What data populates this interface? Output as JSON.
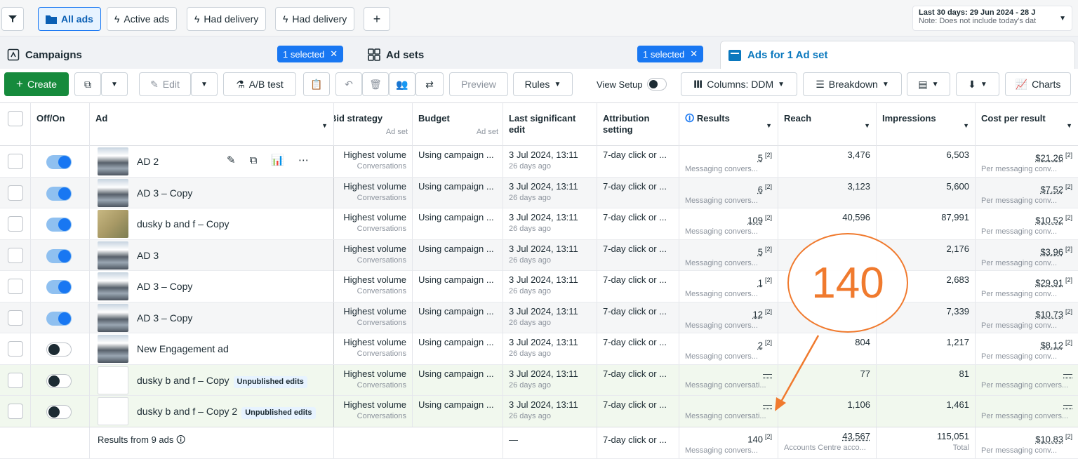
{
  "filters": {
    "all_ads": "All ads",
    "active_ads": "Active ads",
    "had_delivery_1": "Had delivery",
    "had_delivery_2": "Had delivery",
    "add": "+",
    "date_line1": "Last 30 days: 29 Jun 2024 - 28 J",
    "date_line2": "Note: Does not include today's dat"
  },
  "tabs": {
    "campaigns": "Campaigns",
    "campaigns_selected": "1 selected",
    "adsets": "Ad sets",
    "adsets_selected": "1 selected",
    "ads": "Ads for 1 Ad set"
  },
  "toolbar": {
    "create": "Create",
    "edit": "Edit",
    "ab_test": "A/B test",
    "preview": "Preview",
    "rules": "Rules",
    "view_setup": "View Setup",
    "columns": "Columns: DDM",
    "breakdown": "Breakdown",
    "charts": "Charts"
  },
  "headers": {
    "off_on": "Off/On",
    "ad": "Ad",
    "bid_strategy": "Bid strategy",
    "bid_sub": "Ad set",
    "budget": "Budget",
    "budget_sub": "Ad set",
    "last_edit": "Last significant edit",
    "attribution": "Attribution setting",
    "results": "Results",
    "reach": "Reach",
    "impressions": "Impressions",
    "cpr": "Cost per result"
  },
  "rows": [
    {
      "on": true,
      "thumb": "photo",
      "name": "AD 2",
      "badge": "",
      "bid": "Highest volume",
      "bid_sub": "Conversations",
      "budget": "Using campaign ...",
      "edit": "3 Jul 2024, 13:11",
      "edit_sub": "26 days ago",
      "attr": "7-day click or ...",
      "results": "5",
      "results_sub": "Messaging convers...",
      "reach": "3,476",
      "impr": "6,503",
      "cpr": "$21.26",
      "cpr_sub": "Per messaging conv..."
    },
    {
      "on": true,
      "thumb": "photo",
      "name": "AD 3 – Copy",
      "badge": "",
      "bid": "Highest volume",
      "bid_sub": "Conversations",
      "budget": "Using campaign ...",
      "edit": "3 Jul 2024, 13:11",
      "edit_sub": "26 days ago",
      "attr": "7-day click or ...",
      "results": "6",
      "results_sub": "Messaging convers...",
      "reach": "3,123",
      "impr": "5,600",
      "cpr": "$7.52",
      "cpr_sub": "Per messaging conv..."
    },
    {
      "on": true,
      "thumb": "sand",
      "name": "dusky b and f – Copy",
      "badge": "",
      "bid": "Highest volume",
      "bid_sub": "Conversations",
      "budget": "Using campaign ...",
      "edit": "3 Jul 2024, 13:11",
      "edit_sub": "26 days ago",
      "attr": "7-day click or ...",
      "results": "109",
      "results_sub": "Messaging convers...",
      "reach": "40,596",
      "impr": "87,991",
      "cpr": "$10.52",
      "cpr_sub": "Per messaging conv..."
    },
    {
      "on": true,
      "thumb": "photo",
      "name": "AD 3",
      "badge": "",
      "bid": "Highest volume",
      "bid_sub": "Conversations",
      "budget": "Using campaign ...",
      "edit": "3 Jul 2024, 13:11",
      "edit_sub": "26 days ago",
      "attr": "7-day click or ...",
      "results": "5",
      "results_sub": "Messaging convers...",
      "reach": "",
      "impr": "2,176",
      "cpr": "$3.96",
      "cpr_sub": "Per messaging conv..."
    },
    {
      "on": true,
      "thumb": "photo",
      "name": "AD 3 – Copy",
      "badge": "",
      "bid": "Highest volume",
      "bid_sub": "Conversations",
      "budget": "Using campaign ...",
      "edit": "3 Jul 2024, 13:11",
      "edit_sub": "26 days ago",
      "attr": "7-day click or ...",
      "results": "1",
      "results_sub": "Messaging convers...",
      "reach": "",
      "impr": "2,683",
      "cpr": "$29.91",
      "cpr_sub": "Per messaging conv..."
    },
    {
      "on": true,
      "thumb": "photo",
      "name": "AD 3 – Copy",
      "badge": "",
      "bid": "Highest volume",
      "bid_sub": "Conversations",
      "budget": "Using campaign ...",
      "edit": "3 Jul 2024, 13:11",
      "edit_sub": "26 days ago",
      "attr": "7-day click or ...",
      "results": "12",
      "results_sub": "Messaging convers...",
      "reach": "",
      "impr": "7,339",
      "cpr": "$10.73",
      "cpr_sub": "Per messaging conv..."
    },
    {
      "on": false,
      "thumb": "photo",
      "name": "New Engagement ad",
      "badge": "",
      "bid": "Highest volume",
      "bid_sub": "Conversations",
      "budget": "Using campaign ...",
      "edit": "3 Jul 2024, 13:11",
      "edit_sub": "26 days ago",
      "attr": "7-day click or ...",
      "results": "2",
      "results_sub": "Messaging convers...",
      "reach": "804",
      "impr": "1,217",
      "cpr": "$8.12",
      "cpr_sub": "Per messaging conv..."
    },
    {
      "on": false,
      "thumb": "blank",
      "name": "dusky b and f – Copy",
      "badge": "Unpublished edits",
      "bid": "Highest volume",
      "bid_sub": "Conversations",
      "budget": "Using campaign ...",
      "edit": "3 Jul 2024, 13:11",
      "edit_sub": "26 days ago",
      "attr": "7-day click or ...",
      "results": "—",
      "results_sub": "Messaging conversati...",
      "reach": "77",
      "impr": "81",
      "cpr": "—",
      "cpr_sub": "Per messaging convers..."
    },
    {
      "on": false,
      "thumb": "blank",
      "name": "dusky b and f – Copy 2",
      "badge": "Unpublished edits",
      "bid": "Highest volume",
      "bid_sub": "Conversations",
      "budget": "Using campaign ...",
      "edit": "3 Jul 2024, 13:11",
      "edit_sub": "26 days ago",
      "attr": "7-day click or ...",
      "results": "—",
      "results_sub": "Messaging conversati...",
      "reach": "1,106",
      "impr": "1,461",
      "cpr": "—",
      "cpr_sub": "Per messaging convers..."
    }
  ],
  "footer": {
    "label": "Results from 9 ads",
    "edit": "—",
    "attr": "7-day click or ...",
    "results": "140",
    "results_sub": "Messaging convers...",
    "reach": "43,567",
    "reach_sub": "Accounts Centre acco...",
    "impr": "115,051",
    "impr_sub": "Total",
    "cpr": "$10.83",
    "cpr_sub": "Per messaging conv..."
  },
  "sup": "[2]",
  "annotation": "140",
  "colors": {
    "accent": "#1877f2",
    "create": "#168a3c",
    "annotation": "#f07a2e"
  }
}
